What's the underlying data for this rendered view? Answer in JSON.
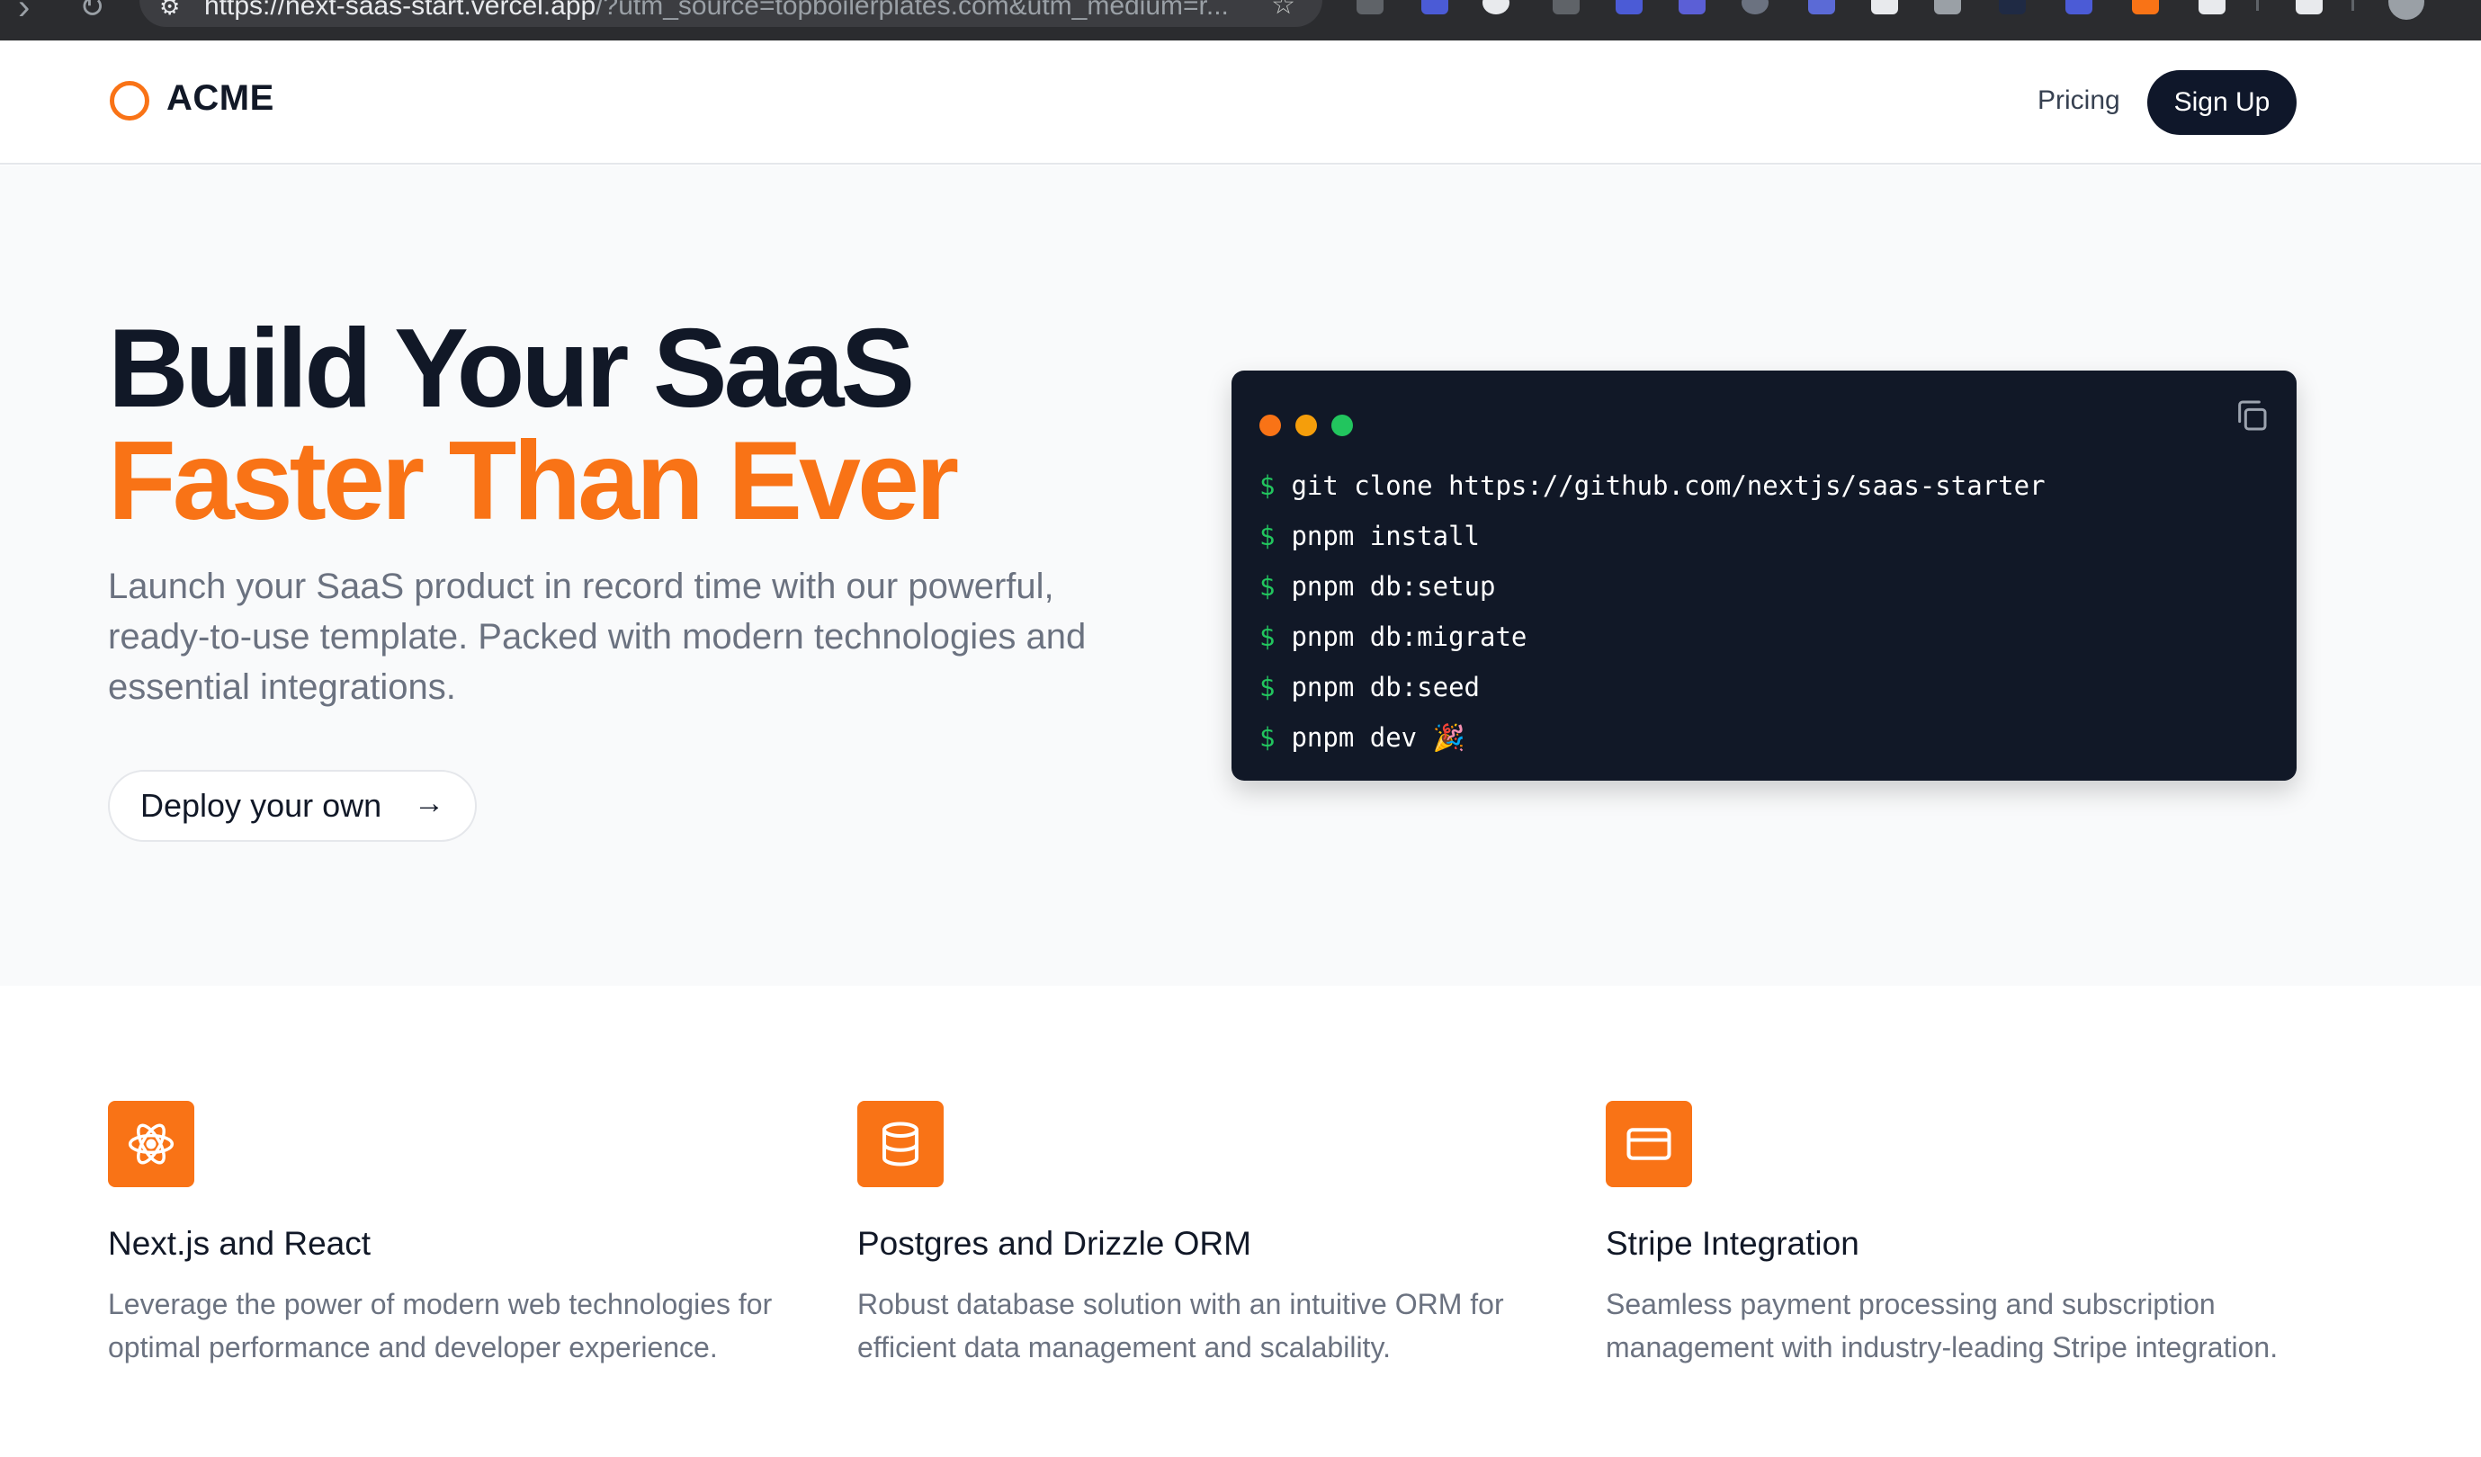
{
  "browser": {
    "url_host": "https://next-saas-start.vercel.app",
    "url_rest": "/?utm_source=topboilerplates.com&utm_medium=r..."
  },
  "header": {
    "logo": "ACME",
    "nav_pricing": "Pricing",
    "signup": "Sign Up"
  },
  "hero": {
    "title_line1": "Build Your SaaS",
    "title_line2": "Faster Than Ever",
    "description": "Launch your SaaS product in record time with our powerful, ready-to-use template. Packed with modern technologies and essential integrations.",
    "cta": "Deploy your own"
  },
  "terminal": {
    "prompt": "$",
    "commands": [
      "git clone https://github.com/nextjs/saas-starter",
      "pnpm install",
      "pnpm db:setup",
      "pnpm db:migrate",
      "pnpm db:seed",
      "pnpm dev 🎉"
    ]
  },
  "features": [
    {
      "icon": "react-atom-icon",
      "title": "Next.js and React",
      "description": "Leverage the power of modern web technologies for optimal performance and developer experience."
    },
    {
      "icon": "database-icon",
      "title": "Postgres and Drizzle ORM",
      "description": "Robust database solution with an intuitive ORM for efficient data management and scalability."
    },
    {
      "icon": "credit-card-icon",
      "title": "Stripe Integration",
      "description": "Seamless payment processing and subscription management with industry-leading Stripe integration."
    }
  ],
  "colors": {
    "accent": "#f97316",
    "dark": "#111827",
    "terminal_bg": "#111827",
    "prompt_green": "#22c55e"
  }
}
